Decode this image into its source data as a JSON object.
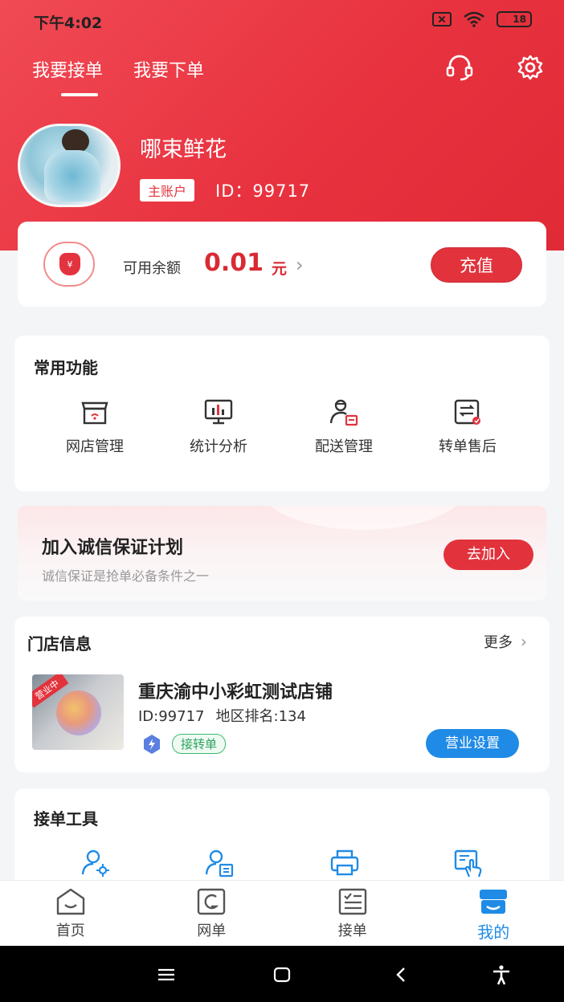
{
  "status_bar": {
    "time": "下午4:02",
    "battery": "18"
  },
  "header": {
    "tabs": [
      {
        "label": "我要接单",
        "active": true
      },
      {
        "label": "我要下单",
        "active": false
      }
    ],
    "icons": [
      "headset-icon",
      "gear-icon"
    ]
  },
  "profile": {
    "name": "哪束鲜花",
    "badge": "主账户",
    "id_text": "ID：99717"
  },
  "balance": {
    "label": "可用余额",
    "value": "0.01",
    "unit": "元",
    "recharge_label": "充值"
  },
  "functions": {
    "title": "常用功能",
    "items": [
      {
        "label": "网店管理",
        "icon": "store-icon"
      },
      {
        "label": "统计分析",
        "icon": "chart-icon"
      },
      {
        "label": "配送管理",
        "icon": "courier-icon"
      },
      {
        "label": "转单售后",
        "icon": "transfer-icon"
      }
    ]
  },
  "banner": {
    "title": "加入诚信保证计划",
    "subtitle": "诚信保证是抢单必备条件之一",
    "button": "去加入"
  },
  "store": {
    "title": "门店信息",
    "more": "更多",
    "status_tag": "营业中",
    "name": "重庆渝中小彩虹测试店铺",
    "id": "ID:99717",
    "rank": "地区排名:134",
    "tag": "接转单",
    "settings_button": "营业设置"
  },
  "tools": {
    "title": "接单工具",
    "icons": [
      "user-settings-icon",
      "user-list-icon",
      "printer-icon",
      "touch-screen-icon"
    ]
  },
  "bottom_nav": {
    "items": [
      {
        "label": "首页",
        "icon": "home-icon",
        "active": false
      },
      {
        "label": "网单",
        "icon": "web-order-icon",
        "active": false
      },
      {
        "label": "接单",
        "icon": "checklist-icon",
        "active": false
      },
      {
        "label": "我的",
        "icon": "profile-store-icon",
        "active": true
      }
    ]
  },
  "colors": {
    "brand_red": "#e2333d",
    "accent_blue": "#1f8be6",
    "success_green": "#2da35e"
  }
}
